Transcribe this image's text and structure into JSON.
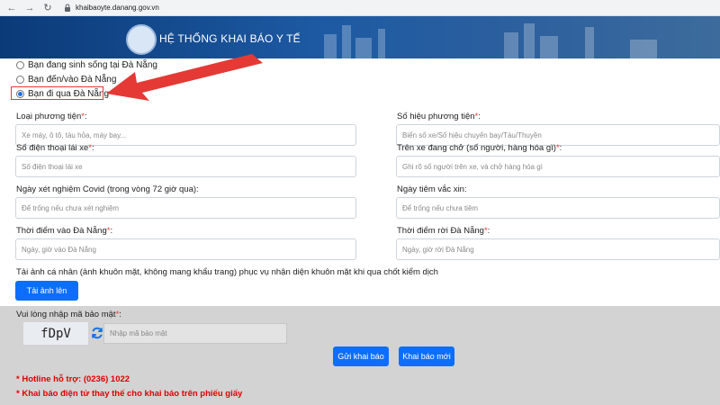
{
  "browser": {
    "url": "khaibaoyte.danang.gov.vn"
  },
  "header": {
    "title": "HỆ THỐNG KHAI BÁO Y TẾ"
  },
  "options": [
    {
      "label": "Bạn đang sinh sống tại Đà Nẵng",
      "checked": false
    },
    {
      "label": "Bạn đến/vào Đà Nẵng",
      "checked": false
    },
    {
      "label": "Bạn đi qua Đà Nẵng",
      "checked": true
    }
  ],
  "form": {
    "vehicle_type": {
      "label": "Loại phương tiện",
      "placeholder": "Xe máy, ô tô, tàu hỏa, máy bay..."
    },
    "vehicle_number": {
      "label": "Số hiệu phương tiện",
      "placeholder": "Biển số xe/Số hiệu chuyến bay/Tàu/Thuyền"
    },
    "driver_phone": {
      "label": "Số điện thoại lái xe",
      "placeholder": "Số điện thoại lái xe"
    },
    "onboard": {
      "label": "Trên xe đang chở (số người, hàng hóa gì)",
      "placeholder": "Ghi rõ số người trên xe, và chở hàng hóa gì"
    },
    "covid_test_date": {
      "label": "Ngày xét nghiệm Covid (trong vòng 72 giờ qua):",
      "placeholder": "Để trống nếu chưa xét nghiệm"
    },
    "vaccine_date": {
      "label": "Ngày tiêm vắc xin:",
      "placeholder": "Để trống nếu chưa tiêm"
    },
    "entry_time": {
      "label": "Thời điểm vào Đà Nẵng",
      "placeholder": "Ngày, giờ vào Đà Nẵng"
    },
    "exit_time": {
      "label": "Thời điểm rời Đà Nẵng",
      "placeholder": "Ngày, giờ rời Đà Nẵng"
    },
    "photo_note": "Tải ảnh cá nhân (ảnh khuôn mặt, không mang khẩu trang) phục vụ nhận diện khuôn mặt khi qua chốt kiểm dịch",
    "upload_label": "Tải ảnh lên",
    "required_mark": "*"
  },
  "captcha": {
    "label": "Vui lòng nhập mã bảo mật",
    "code": "fDpV",
    "placeholder": "Nhập mã bảo mật"
  },
  "actions": {
    "submit_label": "Gửi khai báo",
    "new_label": "Khai báo mới"
  },
  "notes": {
    "hotline": "* Hotline hỗ trợ: (0236) 1022",
    "paper": "* Khai báo điện tử thay thế cho khai báo trên phiếu giấy"
  },
  "colors": {
    "accent": "#0d6efd",
    "required": "#e53935",
    "banner": "#1d5aa3"
  },
  "icons": [
    "back-arrow-icon",
    "forward-arrow-icon",
    "reload-icon",
    "lock-icon",
    "refresh-icon",
    "red-arrow-icon"
  ]
}
